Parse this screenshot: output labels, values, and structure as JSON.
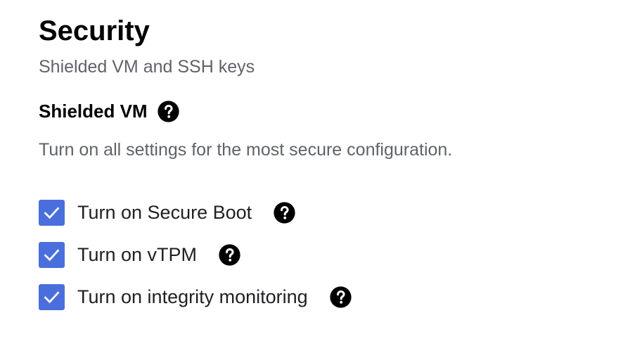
{
  "header": {
    "title": "Security",
    "subtitle": "Shielded VM and SSH keys"
  },
  "shielded_vm": {
    "heading": "Shielded VM",
    "heading_help_icon": "help-circle-icon",
    "description": "Turn on all settings for the most secure configuration.",
    "options": [
      {
        "label": "Turn on Secure Boot",
        "checked": true,
        "help_icon": "help-circle-icon"
      },
      {
        "label": "Turn on vTPM",
        "checked": true,
        "help_icon": "help-circle-icon"
      },
      {
        "label": "Turn on integrity monitoring",
        "checked": true,
        "help_icon": "help-circle-icon"
      }
    ]
  },
  "colors": {
    "checkbox_checked": "#4a6fdc",
    "secondary_text": "#5f6368",
    "primary_text": "#202124"
  }
}
